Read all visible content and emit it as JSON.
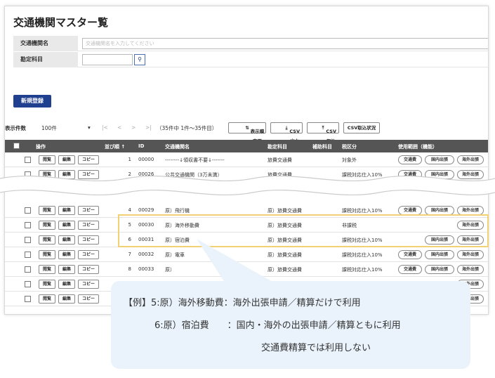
{
  "title": "交通機関マスター覧",
  "form": {
    "name_label": "交通機関名",
    "name_placeholder": "交通機関名を入力してください",
    "account_label": "勘定科目",
    "search_icon": "search-icon"
  },
  "new_button": "新規登録",
  "toolbar": {
    "per_page_label": "表示件数",
    "per_page_value": "100件",
    "pager_first": "|<",
    "pager_prev": "<",
    "pager_next": ">",
    "pager_last": ">|",
    "range_text": "（35件中 1件～35件目）",
    "order_btn": "表示順変更",
    "csv_out": "CSV出力",
    "csv_in": "CSV取込",
    "csv_status": "CSV取込状況"
  },
  "header": {
    "ops": "操作",
    "order": "並び順 ↑",
    "id": "ID",
    "name": "交通機関名",
    "account": "勘定科目",
    "sub": "補助科目",
    "tax": "税区分",
    "scope": "使用範囲（機能）"
  },
  "row_buttons": {
    "view": "閲覧",
    "edit": "編集",
    "copy": "コピー"
  },
  "scope_labels": {
    "transport": "交通費",
    "domestic": "国内出張",
    "overseas": "海外出張"
  },
  "rows": [
    {
      "order": "1",
      "id": "00000",
      "name": "--------↓領収書不要↓-------",
      "account": "旅費交通費",
      "tax": "対象外",
      "scope": [
        "transport",
        "domestic",
        "overseas"
      ]
    },
    {
      "order": "2",
      "id": "00026",
      "name": "公共交通機関（3万未満）",
      "account": "旅費交通費",
      "tax": "課税対応仕入10%",
      "scope": [
        "transport",
        "domestic",
        "overseas"
      ]
    },
    {
      "order": "4",
      "id": "00029",
      "name": "原）飛行機",
      "account": "原）旅費交通費",
      "tax": "課税対応仕入10%",
      "scope": [
        "transport",
        "domestic",
        "overseas"
      ]
    },
    {
      "order": "5",
      "id": "00030",
      "name": "原）海外移動費",
      "account": "原）旅費交通費",
      "tax": "非課税",
      "scope": [
        "overseas"
      ]
    },
    {
      "order": "6",
      "id": "00031",
      "name": "原）宿泊費",
      "account": "原）旅費交通費",
      "tax": "課税対応仕入10%",
      "scope": [
        "domestic",
        "overseas"
      ]
    },
    {
      "order": "7",
      "id": "00032",
      "name": "原）電車",
      "account": "原）旅費交通費",
      "tax": "課税対応仕入10%",
      "scope": [
        "transport",
        "domestic",
        "overseas"
      ]
    },
    {
      "order": "8",
      "id": "00033",
      "name": "原）",
      "account": "原）旅費交通費",
      "tax": "課税対応仕入10%",
      "scope": [
        "transport",
        "domestic",
        "overseas"
      ]
    },
    {
      "order": "",
      "id": "",
      "name": "",
      "account": "",
      "tax": "",
      "scope": [
        "overseas"
      ]
    },
    {
      "order": "",
      "id": "",
      "name": "",
      "account": "",
      "tax": "",
      "scope": [
        "overseas"
      ]
    }
  ],
  "callout": {
    "line1": "【例】5:原）海外移動費：海外出張申請／精算だけで利用",
    "line2": "6:原）宿泊費　　：国内・海外の出張申請／精算ともに利用",
    "line3": "交通費精算では利用しない"
  },
  "colors": {
    "primary": "#1f3f8f",
    "header_bg": "#555555",
    "highlight": "#f2d074",
    "callout_bg": "#eaf3fb"
  }
}
